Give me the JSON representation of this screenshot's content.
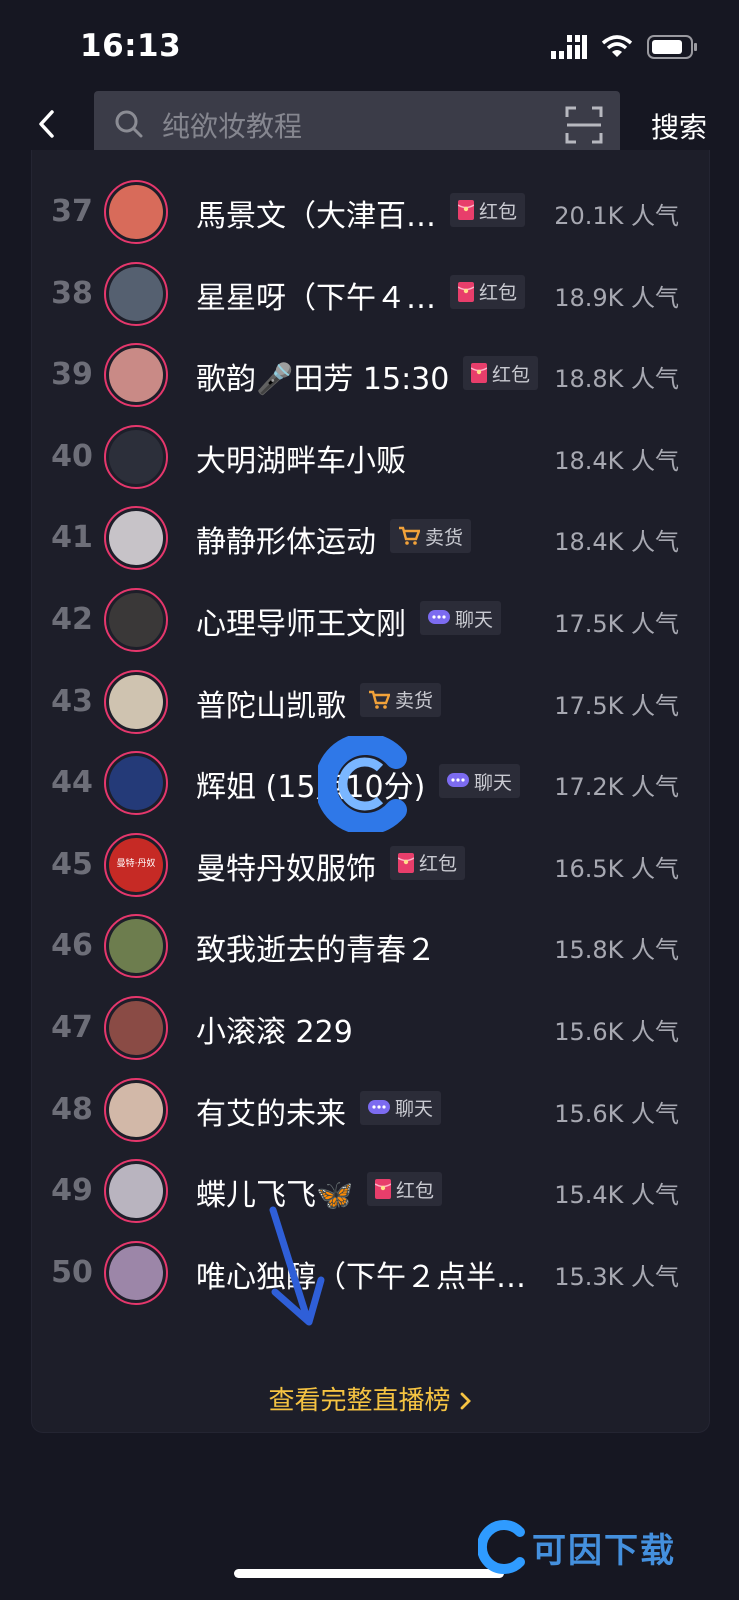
{
  "status_bar": {
    "time": "16:13"
  },
  "search": {
    "placeholder": "纯欲妆教程",
    "button_label": "搜索"
  },
  "rows": [
    {
      "rank": "37",
      "name": "馬景文（大津百…",
      "tag": "红包",
      "tag_type": "hongbao",
      "popularity": "20.1K 人气",
      "avatar_color": "#d86b5a"
    },
    {
      "rank": "38",
      "name": "星星呀（下午４…",
      "tag": "红包",
      "tag_type": "hongbao",
      "popularity": "18.9K 人气",
      "avatar_color": "#556070"
    },
    {
      "rank": "39",
      "name": "歌韵🎤田芳 15:30",
      "tag": "红包",
      "tag_type": "hongbao",
      "popularity": "18.8K 人气",
      "avatar_color": "#c98a86"
    },
    {
      "rank": "40",
      "name": "大明湖畔车小贩",
      "tag": "",
      "tag_type": "",
      "popularity": "18.4K 人气",
      "avatar_color": "#2c2f3a"
    },
    {
      "rank": "41",
      "name": "静静形体运动",
      "tag": "卖货",
      "tag_type": "cart",
      "popularity": "18.4K 人气",
      "avatar_color": "#c7c3c8"
    },
    {
      "rank": "42",
      "name": "心理导师王文刚",
      "tag": "聊天",
      "tag_type": "chat",
      "popularity": "17.5K 人气",
      "avatar_color": "#3a3838"
    },
    {
      "rank": "43",
      "name": "普陀山凯歌",
      "tag": "卖货",
      "tag_type": "cart",
      "popularity": "17.5K 人气",
      "avatar_color": "#cfc3b0"
    },
    {
      "rank": "44",
      "name": "辉姐 (15点10分)",
      "tag": "聊天",
      "tag_type": "chat",
      "popularity": "17.2K 人气",
      "avatar_color": "#243a78"
    },
    {
      "rank": "45",
      "name": "曼特丹奴服饰",
      "tag": "红包",
      "tag_type": "hongbao",
      "popularity": "16.5K 人气",
      "avatar_color": "#c62a25",
      "avatar_text": "曼特·丹奴"
    },
    {
      "rank": "46",
      "name": "致我逝去的青春２",
      "tag": "",
      "tag_type": "",
      "popularity": "15.8K 人气",
      "avatar_color": "#6d7d4e"
    },
    {
      "rank": "47",
      "name": "小滚滚 229",
      "tag": "",
      "tag_type": "",
      "popularity": "15.6K 人气",
      "avatar_color": "#8a4b45"
    },
    {
      "rank": "48",
      "name": "有艾的未来",
      "tag": "聊天",
      "tag_type": "chat",
      "popularity": "15.6K 人气",
      "avatar_color": "#d2b8a8"
    },
    {
      "rank": "49",
      "name": "蝶儿飞飞🦋",
      "tag": "红包",
      "tag_type": "hongbao",
      "popularity": "15.4K 人气",
      "avatar_color": "#b9b4bf"
    },
    {
      "rank": "50",
      "name": "唯心独醇（下午２点半…",
      "tag": "",
      "tag_type": "",
      "popularity": "15.3K 人气",
      "avatar_color": "#9c86a8"
    }
  ],
  "footer": {
    "more_label": "查看完整直播榜",
    "watermark_text": "可因下载"
  },
  "colors": {
    "background": "#161722",
    "accent_gold": "#f5c342",
    "avatar_ring": "#e5376c",
    "hongbao": "#e83e6b",
    "cart": "#f2a23a",
    "chat": "#7c6bf0"
  }
}
